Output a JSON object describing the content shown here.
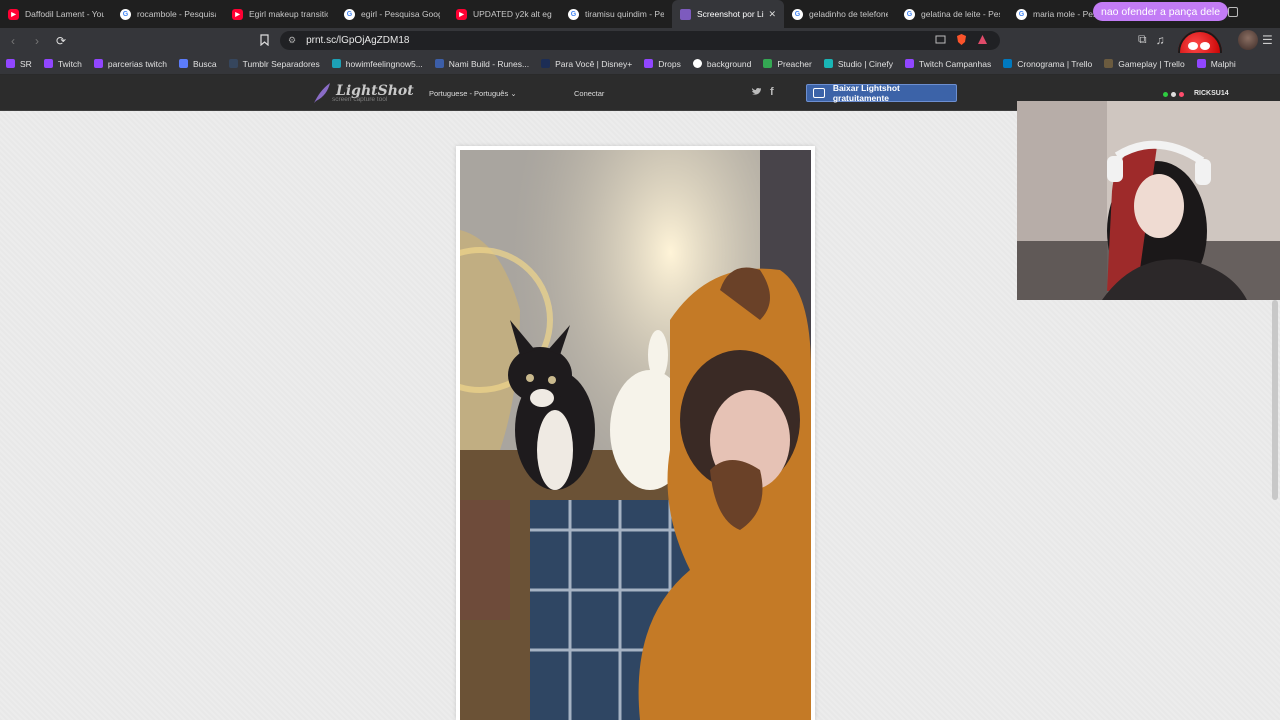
{
  "tabs": [
    {
      "title": "Daffodil Lament - You",
      "icon": "youtube-icon"
    },
    {
      "title": "rocambole - Pesquisa",
      "icon": "google-icon"
    },
    {
      "title": "Egirl makeup transitio",
      "icon": "youtube-icon"
    },
    {
      "title": "egirl - Pesquisa Googl",
      "icon": "google-icon"
    },
    {
      "title": "UPDATED y2k alt egirl",
      "icon": "youtube-icon"
    },
    {
      "title": "tiramisu quindim - Pe",
      "icon": "google-icon"
    },
    {
      "title": "Screenshot por Li",
      "icon": "lightshot-icon",
      "active": true
    },
    {
      "title": "geladinho de telefone",
      "icon": "google-icon"
    },
    {
      "title": "gelatina de leite - Pes",
      "icon": "google-icon"
    },
    {
      "title": "maria mole - Pes",
      "icon": "google-icon"
    }
  ],
  "active_tab_close": "✕",
  "overlay_message": "nao ofender a pança dele",
  "address_bar": {
    "url": "prnt.sc/lGpOjAgZDM18"
  },
  "bookmarks": [
    {
      "label": "SR",
      "icon": "twitch-icon",
      "color": "#9146ff"
    },
    {
      "label": "Twitch",
      "icon": "twitch-icon",
      "color": "#9146ff"
    },
    {
      "label": "parcerias twitch",
      "icon": "twitch-icon",
      "color": "#9146ff"
    },
    {
      "label": "Busca",
      "icon": "triangle-icon",
      "color": "#5c7cfa"
    },
    {
      "label": "Tumblr Separadores",
      "icon": "tumblr-icon",
      "color": "#36465d"
    },
    {
      "label": "howimfeelingnow5...",
      "icon": "l-icon",
      "color": "#1da1b6"
    },
    {
      "label": "Nami Build - Runes...",
      "icon": "league-icon",
      "color": "#3c5ea8"
    },
    {
      "label": "Para Você | Disney+",
      "icon": "disney-icon",
      "color": "#1c2d55"
    },
    {
      "label": "Drops",
      "icon": "twitch-icon",
      "color": "#9146ff"
    },
    {
      "label": "background",
      "icon": "google-icon",
      "color": "#ffffff"
    },
    {
      "label": "Preacher",
      "icon": "drive-icon",
      "color": "#34a853"
    },
    {
      "label": "Studio | Cinefy",
      "icon": "cinefy-icon",
      "color": "#19b5b5"
    },
    {
      "label": "Twitch Campanhas",
      "icon": "twitch-icon",
      "color": "#9146ff"
    },
    {
      "label": "Cronograma | Trello",
      "icon": "trello-icon",
      "color": "#0079bf"
    },
    {
      "label": "Gameplay | Trello",
      "icon": "trello-icon",
      "color": "#6b5b3f"
    },
    {
      "label": "Malphi",
      "icon": "twitch-icon",
      "color": "#9146ff"
    }
  ],
  "lightshot": {
    "logo_name": "LightShot",
    "logo_tagline": "screen capture tool",
    "language": "Portuguese - Português",
    "language_chevron": "⌄",
    "connect": "Conectar",
    "twitter": "🐦",
    "facebook": "f",
    "download_button": "Baixar Lightshot gratuitamente"
  },
  "stream": {
    "username": "RICKSU14"
  },
  "colors": {
    "accent": "#3c63a8",
    "overlay_pill": "#c27cf5",
    "tab_bg": "#1f1f1f",
    "toolbar_bg": "#35363a"
  }
}
